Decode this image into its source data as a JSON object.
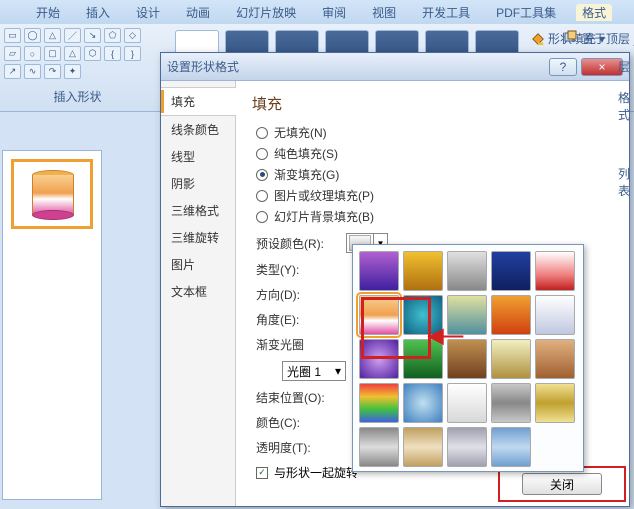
{
  "ribbon": {
    "tabs": [
      "开始",
      "插入",
      "设计",
      "动画",
      "幻灯片放映",
      "审阅",
      "视图",
      "开发工具",
      "PDF工具集",
      "格式"
    ],
    "shapes_label": "插入形状",
    "fill_label": "形状填充",
    "top_layer": "置于顶层"
  },
  "dialog": {
    "title": "设置形状格式",
    "help_icon": "?",
    "close_icon": "×",
    "nav": [
      "填充",
      "线条颜色",
      "线型",
      "阴影",
      "三维格式",
      "三维旋转",
      "图片",
      "文本框"
    ],
    "section": "填充",
    "radios": {
      "none": "无填充(N)",
      "solid": "纯色填充(S)",
      "gradient": "渐变填充(G)",
      "picture": "图片或纹理填充(P)",
      "slide_bg": "幻灯片背景填充(B)"
    },
    "fields": {
      "preset": "预设颜色(R):",
      "type": "类型(Y):",
      "direction": "方向(D):",
      "angle": "角度(E):",
      "stops": "渐变光圈",
      "stop_combo": "光圈 1",
      "stop_pos": "结束位置(O):",
      "color": "颜色(C):",
      "transparency": "透明度(T):",
      "rotate_with_shape": "与形状一起旋转"
    },
    "close_btn": "关闭"
  },
  "preset_swatches": [
    "linear-gradient(#b060d0,#4020a0)",
    "linear-gradient(#f0c030,#b07010)",
    "linear-gradient(#e0e0e0,#888)",
    "linear-gradient(#2040a0,#102060)",
    "linear-gradient(#fff,#f08080 60%,#c02020)",
    "linear-gradient(#f8d090,#f0a050 50%,#fff 65%,#e050a0)",
    "radial-gradient(#40c0d0,#106080)",
    "linear-gradient(#e0e0a0,#5090a0)",
    "linear-gradient(#f0a030,#d04010)",
    "linear-gradient(#fff,#c0c8e0)",
    "radial-gradient(#d0a0f0,#5020a0)",
    "linear-gradient(#50c050,#106020)",
    "linear-gradient(#c09050,#704020)",
    "linear-gradient(#f0f0c0,#b09040)",
    "linear-gradient(#e0b080,#a06030)",
    "linear-gradient(#f04040,#f0c030,#40c040,#4060e0)",
    "radial-gradient(#c0e0f0,#4080c0)",
    "linear-gradient(#fff,#d8d8d8)",
    "linear-gradient(#c8c8c8,#888,#c8c8c8)",
    "linear-gradient(#f0e090,#c0a030,#f0e090)",
    "linear-gradient(#888,#ddd,#888)",
    "linear-gradient(#c0a060,#f0e0c0,#c0a060)",
    "linear-gradient(#a0a0b0,#e0e0e8,#a0a0b0)",
    "linear-gradient(#70a0d0,#c0d8f0,#70a0d0)"
  ],
  "right_edge": [
    "层",
    "格式",
    "列表"
  ]
}
